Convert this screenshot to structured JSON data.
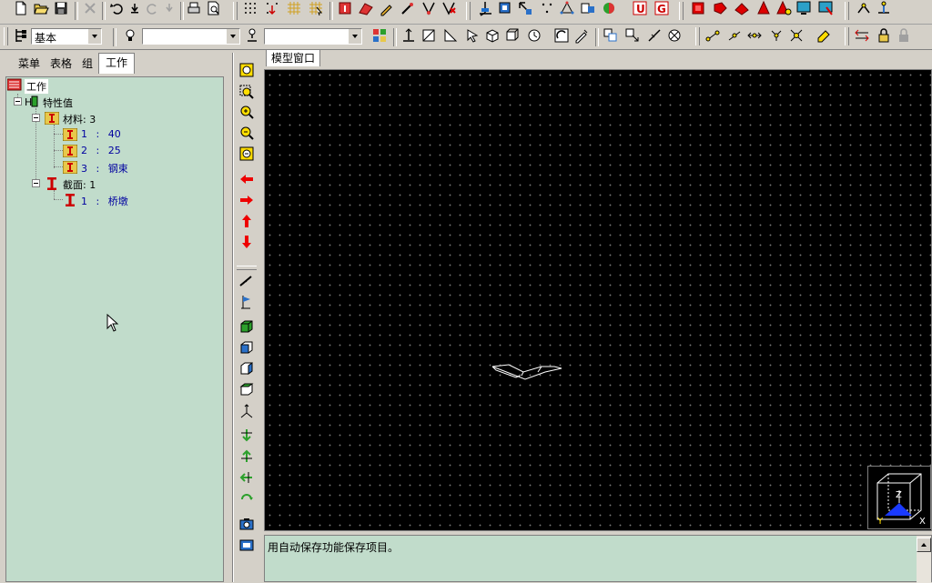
{
  "toolbar": {
    "view_mode_value": "基本",
    "combo2_value": "",
    "combo3_value": ""
  },
  "left_panel": {
    "tabs": [
      {
        "label": "菜单"
      },
      {
        "label": "表格"
      },
      {
        "label": "组"
      },
      {
        "label": "工作"
      }
    ],
    "tree": {
      "root": "工作",
      "properties": "特性值",
      "materials_label": "材料: 3",
      "materials": [
        {
          "id": "1",
          "sep": ":",
          "name": "40"
        },
        {
          "id": "2",
          "sep": ":",
          "name": "25"
        },
        {
          "id": "3",
          "sep": ":",
          "name": "钢束"
        }
      ],
      "sections_label": "截面: 1",
      "sections": [
        {
          "id": "1",
          "sep": ":",
          "name": "桥墩"
        }
      ]
    }
  },
  "model_window": {
    "tab_label": "模型窗口"
  },
  "message_pane": {
    "text": "用自动保存功能保存项目。"
  },
  "colors": {
    "tree_bg": "#c1dccb",
    "canvas_bg": "#000000",
    "chrome": "#d4d0c8",
    "tree_link": "#0000a0"
  }
}
